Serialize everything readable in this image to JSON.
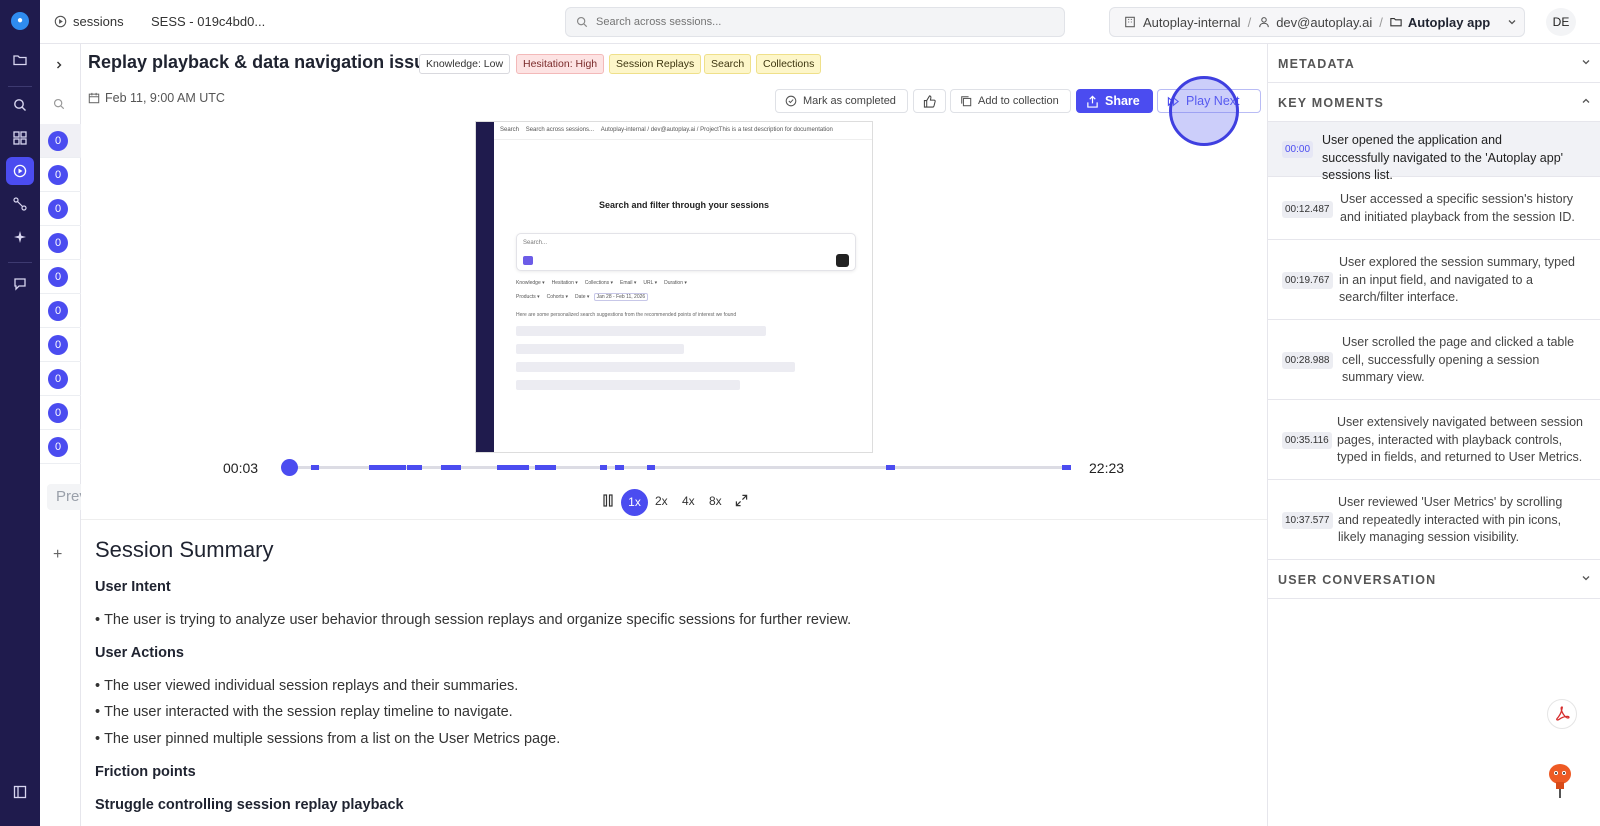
{
  "topbar": {
    "breadcrumb_sessions": "sessions",
    "breadcrumb_session_id": "SESS - 019c4bd0...",
    "search_placeholder": "Search across sessions...",
    "org": "Autoplay-internal",
    "user": "dev@autoplay.ai",
    "project": "Autoplay app",
    "avatar_initials": "DE"
  },
  "sidebar_list": {
    "counts": [
      "0",
      "0",
      "0",
      "0",
      "0",
      "0",
      "0",
      "0",
      "0",
      "0"
    ],
    "preview_text": "Prev"
  },
  "session": {
    "title": "Replay playback & data navigation issues",
    "tags": [
      {
        "label": "Knowledge: Low",
        "color": "#ffffff",
        "border": "#d9d9de",
        "text": "#333333"
      },
      {
        "label": "Hesitation: High",
        "color": "#fde3e3",
        "border": "#f3b9b9",
        "text": "#7a2a2a"
      },
      {
        "label": "Session Replays",
        "color": "#fdf6c9",
        "border": "#efe08a",
        "text": "#3d3510"
      },
      {
        "label": "Search",
        "color": "#fdf6c9",
        "border": "#efe08a",
        "text": "#3d3510"
      },
      {
        "label": "Collections",
        "color": "#fdf6c9",
        "border": "#efe08a",
        "text": "#3d3510"
      }
    ],
    "date": "Feb 11, 9:00 AM UTC"
  },
  "actions": {
    "mark_completed": "Mark as completed",
    "add_collection": "Add to collection",
    "share": "Share",
    "play_next": "Play Next"
  },
  "player": {
    "frame": {
      "search_label": "Search",
      "search_placeholder": "Search across sessions...",
      "org": "Autoplay-internal",
      "user": "dev@autoplay.ai",
      "project": "ProjectThis is a test description for documentation",
      "heading": "Search and filter through your sessions",
      "input_placeholder": "Search...",
      "chips": [
        "Knowledge",
        "Hesitation",
        "Collections",
        "Email",
        "URL",
        "Duration"
      ],
      "chips2": [
        "Products",
        "Cohorts",
        "Date",
        "Jan 28 - Feb 11, 2026"
      ],
      "note": "Here are some personalized search suggestions from the recommended points of interest we found"
    },
    "current_time": "00:03",
    "total_time": "22:23",
    "progress": 0.002,
    "speeds": [
      "1x",
      "2x",
      "4x",
      "8x"
    ],
    "selected_speed": "1x"
  },
  "summary": {
    "title": "Session Summary",
    "intent_heading": "User Intent",
    "intent_items": [
      "The user is trying to analyze user behavior through session replays and organize specific sessions for further review."
    ],
    "actions_heading": "User Actions",
    "action_items": [
      "The user viewed individual session replays and their summaries.",
      "The user interacted with the session replay timeline to navigate.",
      "The user pinned multiple sessions from a list on the User Metrics page."
    ],
    "friction_heading": "Friction points",
    "struggle_heading": "Struggle controlling session replay playback"
  },
  "right_panel": {
    "metadata_label": "METADATA",
    "key_moments_label": "KEY MOMENTS",
    "key_moments": [
      {
        "time": "00:00",
        "text": "User opened the application and successfully navigated to the 'Autoplay app' sessions list."
      },
      {
        "time": "00:12.487",
        "text": "User accessed a specific session's history and initiated playback from the session ID."
      },
      {
        "time": "00:19.767",
        "text": "User explored the session summary, typed in an input field, and navigated to a search/filter interface."
      },
      {
        "time": "00:28.988",
        "text": "User scrolled the page and clicked a table cell, successfully opening a session summary view."
      },
      {
        "time": "00:35.116",
        "text": "User extensively navigated between session pages, interacted with playback controls, typed in fields, and returned to User Metrics."
      },
      {
        "time": "10:37.577",
        "text": "User reviewed 'User Metrics' by scrolling and repeatedly interacted with pin icons, likely managing session visibility."
      }
    ],
    "user_conversation_label": "USER CONVERSATION"
  },
  "colors": {
    "accent": "#4b4cf0",
    "rail": "#1f1b4d"
  }
}
